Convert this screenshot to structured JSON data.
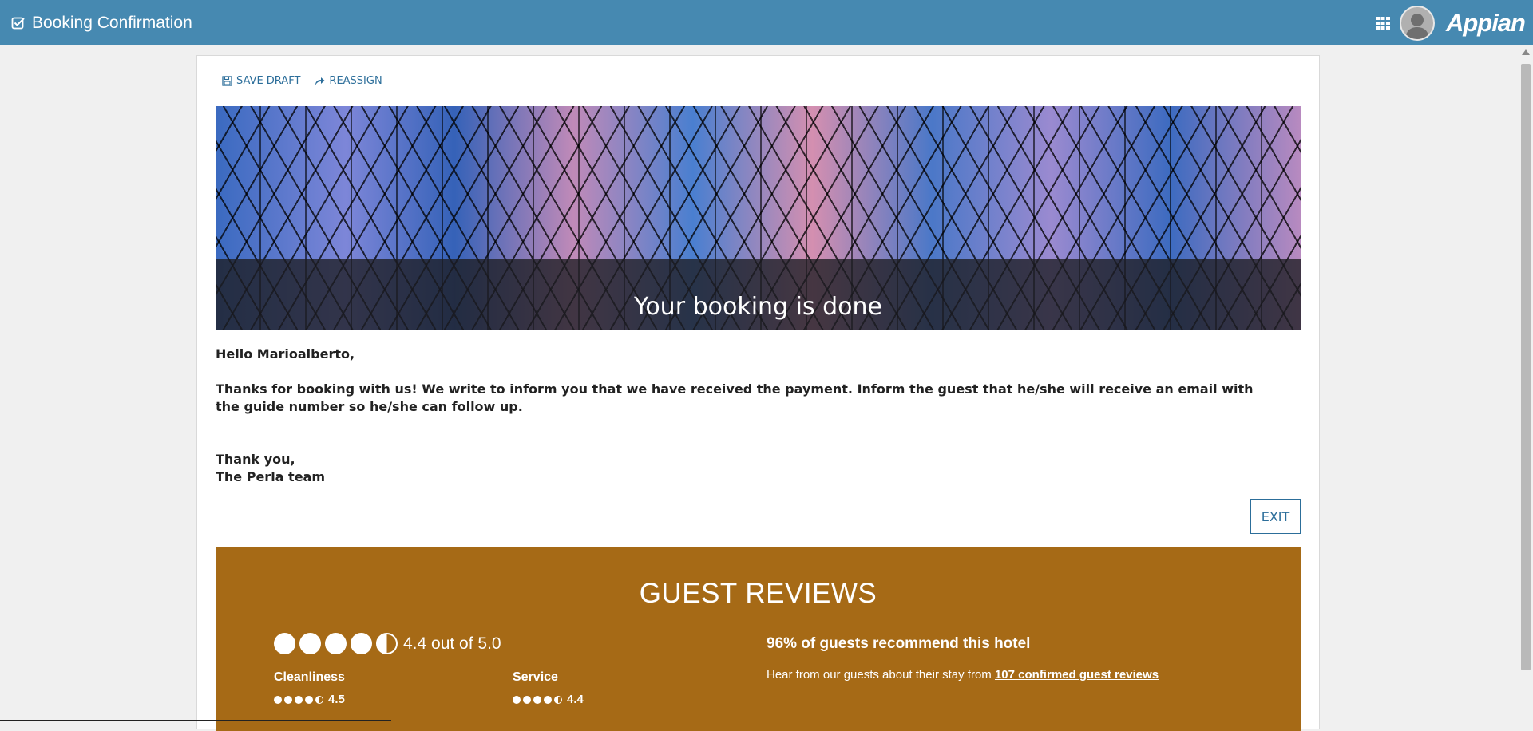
{
  "header": {
    "title": "Booking Confirmation",
    "brand": "Appian",
    "bar_color": "#4689b1"
  },
  "toolbar": {
    "save_draft": "SAVE DRAFT",
    "reassign": "REASSIGN"
  },
  "banner": {
    "text": "Your booking is done"
  },
  "message": {
    "greeting": "Hello Marioalberto,",
    "body": "Thanks for booking with us! We write to inform you that we have received the payment. Inform the guest that he/she will receive an email with the guide number so he/she can follow up.",
    "closing": "Thank you,",
    "signature": "The Perla team"
  },
  "exit_label": "EXIT",
  "reviews": {
    "title": "GUEST REVIEWS",
    "bg_color": "#a66a16",
    "overall": {
      "score_text": "4.4 out of 5.0",
      "value": 4.4
    },
    "cleanliness": {
      "label": "Cleanliness",
      "value_text": "4.5",
      "value": 4.5
    },
    "service": {
      "label": "Service",
      "value_text": "4.4",
      "value": 4.4
    },
    "recommend": "96% of guests recommend this hotel",
    "hear_prefix": "Hear from our guests about their stay from ",
    "hear_link": "107 confirmed guest reviews"
  },
  "icons": {
    "title_icon": "checkbox-icon",
    "apps_icon": "grid-icon",
    "save_icon": "floppy-icon",
    "reassign_icon": "share-arrow-icon"
  }
}
